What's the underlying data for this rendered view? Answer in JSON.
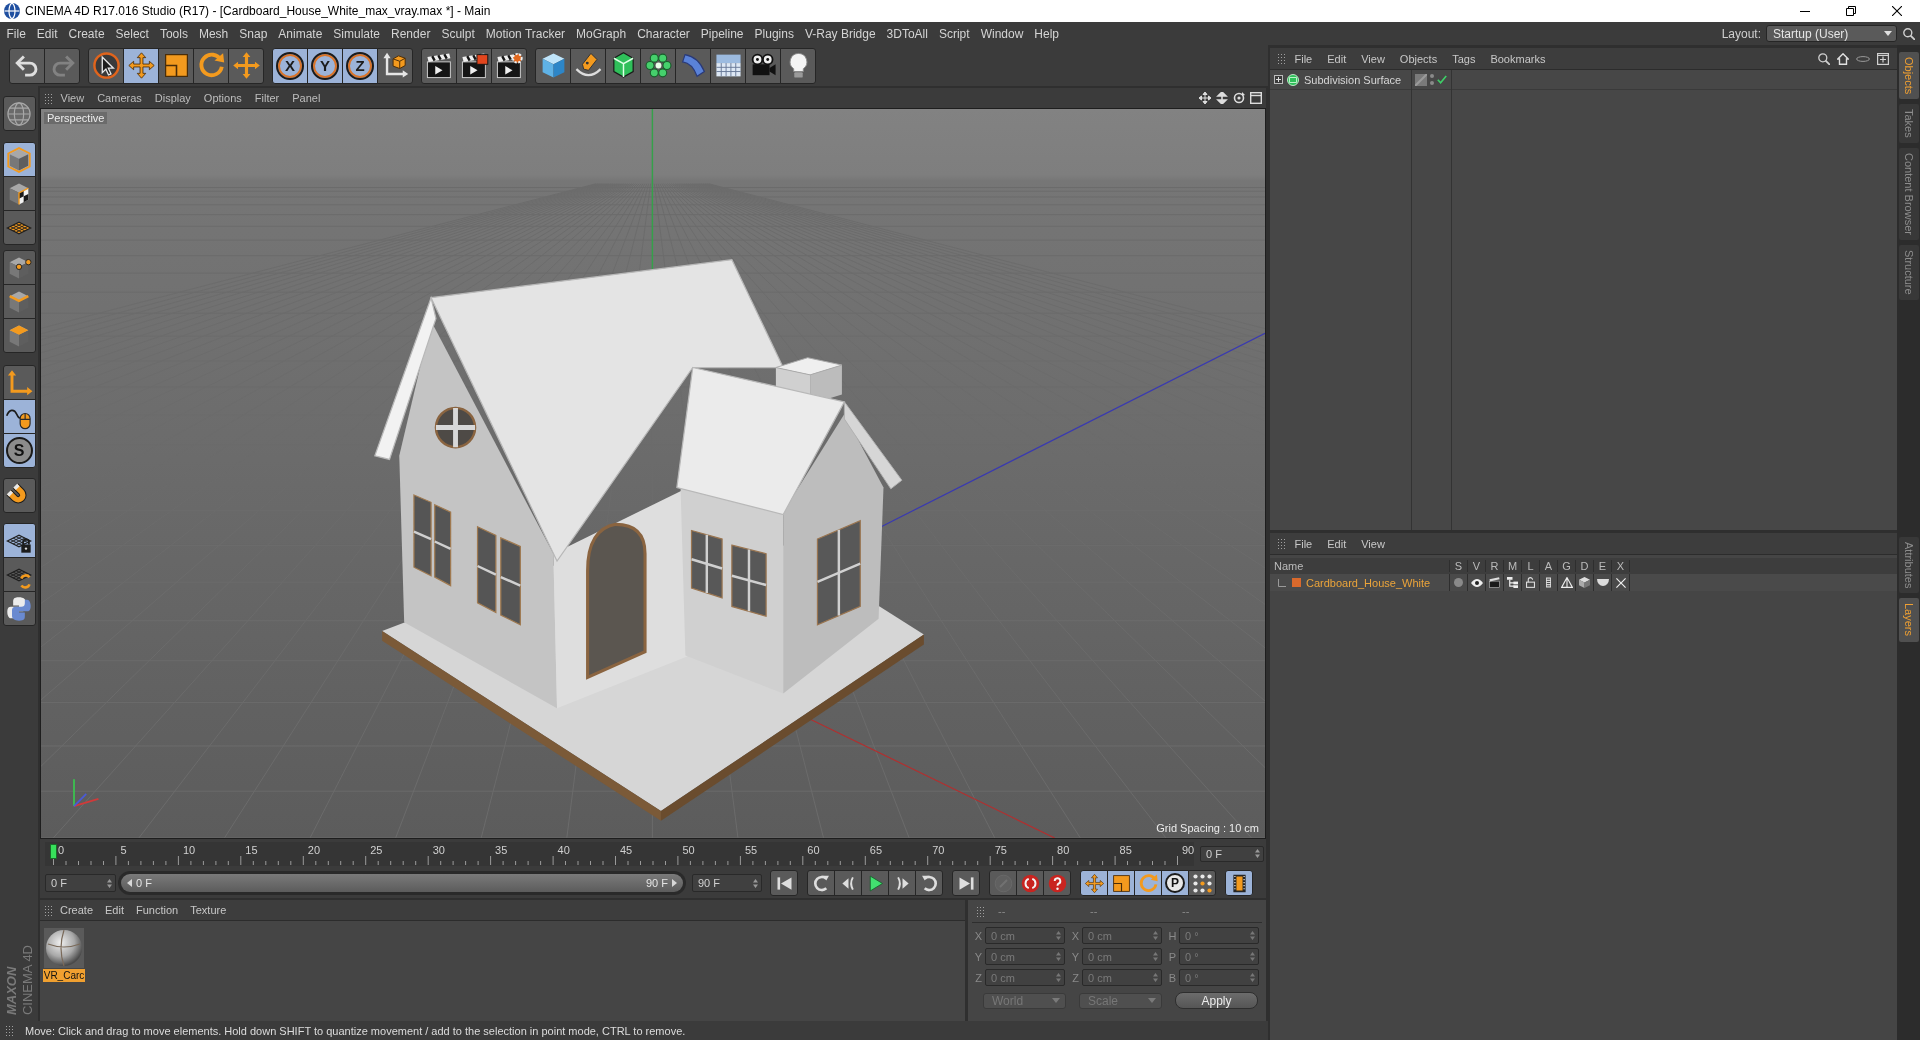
{
  "window": {
    "title": "CINEMA 4D R17.016 Studio (R17) - [Cardboard_House_White_max_vray.max *] - Main"
  },
  "menu_bar": {
    "items": [
      "File",
      "Edit",
      "Create",
      "Select",
      "Tools",
      "Mesh",
      "Snap",
      "Animate",
      "Simulate",
      "Render",
      "Sculpt",
      "Motion Tracker",
      "MoGraph",
      "Character",
      "Pipeline",
      "Plugins",
      "V-Ray Bridge",
      "3DToAll",
      "Script",
      "Window",
      "Help"
    ],
    "layout_label": "Layout:",
    "layout_value": "Startup (User)"
  },
  "toolbar": [
    [
      {
        "kind": "undo",
        "on": false,
        "disabled": false
      },
      {
        "kind": "redo",
        "on": false,
        "disabled": true
      }
    ],
    [
      {
        "kind": "live-selection",
        "on": false,
        "disabled": false
      },
      {
        "kind": "move",
        "on": true,
        "disabled": false
      },
      {
        "kind": "scale",
        "on": false,
        "disabled": false
      },
      {
        "kind": "rotate",
        "on": false,
        "disabled": false
      },
      {
        "kind": "recent-tool",
        "on": false,
        "disabled": false
      }
    ],
    [
      {
        "kind": "axis-lock",
        "label": "X",
        "on": true,
        "disabled": false
      },
      {
        "kind": "axis-lock",
        "label": "Y",
        "on": true,
        "disabled": false
      },
      {
        "kind": "axis-lock",
        "label": "Z",
        "on": true,
        "disabled": false
      },
      {
        "kind": "coordinate-system",
        "on": false,
        "disabled": false
      }
    ],
    [
      {
        "kind": "render-view",
        "on": false,
        "disabled": false
      },
      {
        "kind": "render-picture-viewer",
        "on": false,
        "disabled": false
      },
      {
        "kind": "render-settings",
        "on": false,
        "disabled": false
      }
    ],
    [
      {
        "kind": "cube",
        "on": false,
        "disabled": false
      },
      {
        "kind": "pen",
        "on": false,
        "disabled": false
      },
      {
        "kind": "subdivision",
        "on": false,
        "disabled": false
      },
      {
        "kind": "cloner",
        "on": false,
        "disabled": false
      },
      {
        "kind": "deformer",
        "on": false,
        "disabled": false
      },
      {
        "kind": "floor",
        "on": false,
        "disabled": false
      },
      {
        "kind": "camera",
        "on": false,
        "disabled": false
      },
      {
        "kind": "light",
        "on": false,
        "disabled": false
      }
    ]
  ],
  "left_toolbar": [
    [
      {
        "kind": "globe",
        "on": false
      }
    ],
    [
      {
        "kind": "model",
        "on": true
      },
      {
        "kind": "texture",
        "on": false
      },
      {
        "kind": "workplane",
        "on": false
      }
    ],
    [
      {
        "kind": "points",
        "on": false
      },
      {
        "kind": "edges",
        "on": false
      },
      {
        "kind": "polygons",
        "on": false
      }
    ],
    [
      {
        "kind": "axis",
        "on": false
      },
      {
        "kind": "tweak",
        "on": true
      },
      {
        "kind": "soft-selection",
        "label": "S",
        "on": true
      }
    ],
    [
      {
        "kind": "snap",
        "on": false
      }
    ],
    [
      {
        "kind": "workplane-lock",
        "on": true
      },
      {
        "kind": "workplane-align",
        "on": false
      },
      {
        "kind": "python",
        "on": false
      }
    ]
  ],
  "viewport": {
    "menu": [
      "View",
      "Cameras",
      "Display",
      "Options",
      "Filter",
      "Panel"
    ],
    "camera": "Perspective",
    "grid_spacing": "Grid Spacing : 10 cm"
  },
  "timeline": {
    "ticks": [
      "0",
      "5",
      "10",
      "15",
      "20",
      "25",
      "30",
      "35",
      "40",
      "45",
      "50",
      "55",
      "60",
      "65",
      "70",
      "75",
      "80",
      "85",
      "90"
    ],
    "level": 0,
    "current_frame": "0 F"
  },
  "transport": {
    "start_frame": "0 F",
    "range": {
      "start": "0 F",
      "end": "90 F",
      "level": 1
    },
    "end_frame": "90 F",
    "buttons": [
      [
        {
          "kind": "go-start",
          "on": false,
          "disabled": false
        }
      ],
      [
        {
          "kind": "prev-key",
          "on": false,
          "disabled": false
        },
        {
          "kind": "prev-frame",
          "on": false,
          "disabled": false
        },
        {
          "kind": "play",
          "on": false,
          "disabled": false
        },
        {
          "kind": "next-frame",
          "on": false,
          "disabled": false
        },
        {
          "kind": "next-key",
          "on": false,
          "disabled": false
        }
      ],
      [
        {
          "kind": "go-end",
          "on": false,
          "disabled": false
        }
      ],
      [
        {
          "kind": "record-selected",
          "on": false,
          "disabled": true
        },
        {
          "kind": "record",
          "on": false,
          "disabled": false
        },
        {
          "kind": "autokey",
          "on": false,
          "disabled": false
        }
      ],
      [
        {
          "kind": "key-position",
          "on": true,
          "disabled": false
        },
        {
          "kind": "key-scale",
          "on": true,
          "disabled": false
        },
        {
          "kind": "key-rotation",
          "on": true,
          "disabled": false
        },
        {
          "kind": "key-parameter",
          "label": "P",
          "on": true,
          "disabled": false
        },
        {
          "kind": "key-point-level",
          "on": false,
          "disabled": false
        }
      ],
      [
        {
          "kind": "timeline",
          "on": true,
          "disabled": false
        }
      ]
    ]
  },
  "materials": {
    "menu": [
      "Create",
      "Edit",
      "Function",
      "Texture"
    ],
    "items": [
      {
        "name": "VR_Carc",
        "selected": true
      }
    ]
  },
  "coordinates": {
    "headers": [
      "--",
      "--",
      "--"
    ],
    "rows": [
      [
        {
          "axis": "X",
          "value": "0 cm"
        },
        {
          "axis": "X",
          "value": "0 cm"
        },
        {
          "axis": "H",
          "value": "0 °"
        }
      ],
      [
        {
          "axis": "Y",
          "value": "0 cm"
        },
        {
          "axis": "Y",
          "value": "0 cm"
        },
        {
          "axis": "P",
          "value": "0 °"
        }
      ],
      [
        {
          "axis": "Z",
          "value": "0 cm"
        },
        {
          "axis": "Z",
          "value": "0 cm"
        },
        {
          "axis": "B",
          "value": "0 °"
        }
      ]
    ],
    "dropdowns": [
      "World",
      "Scale"
    ],
    "apply": "Apply"
  },
  "status_bar": {
    "text": "Move: Click and drag to move elements. Hold down SHIFT to quantize movement / add to the selection in point mode, CTRL to remove."
  },
  "logo": {
    "brand": "MAXON",
    "product": "CINEMA 4D"
  },
  "objects": {
    "menu": [
      "File",
      "Edit",
      "View",
      "Objects",
      "Tags",
      "Bookmarks"
    ],
    "items": [
      {
        "name": "Subdivision Surface",
        "expanded": false,
        "enabled": true
      }
    ]
  },
  "layers": {
    "menu": [
      "File",
      "Edit",
      "View"
    ],
    "columns": [
      "Name",
      "S",
      "V",
      "R",
      "M",
      "L",
      "A",
      "G",
      "D",
      "E",
      "X"
    ],
    "rows": [
      {
        "name": "Cardboard_House_White",
        "color": "#d9692c"
      }
    ]
  },
  "side_tabs": {
    "upper": [
      {
        "label": "Objects",
        "selected": true
      },
      {
        "label": "Takes",
        "selected": false
      },
      {
        "label": "Content Browser",
        "selected": false
      },
      {
        "label": "Structure",
        "selected": false
      }
    ],
    "lower": [
      {
        "label": "Attributes",
        "selected": false
      },
      {
        "label": "Layers",
        "selected": true
      }
    ]
  }
}
